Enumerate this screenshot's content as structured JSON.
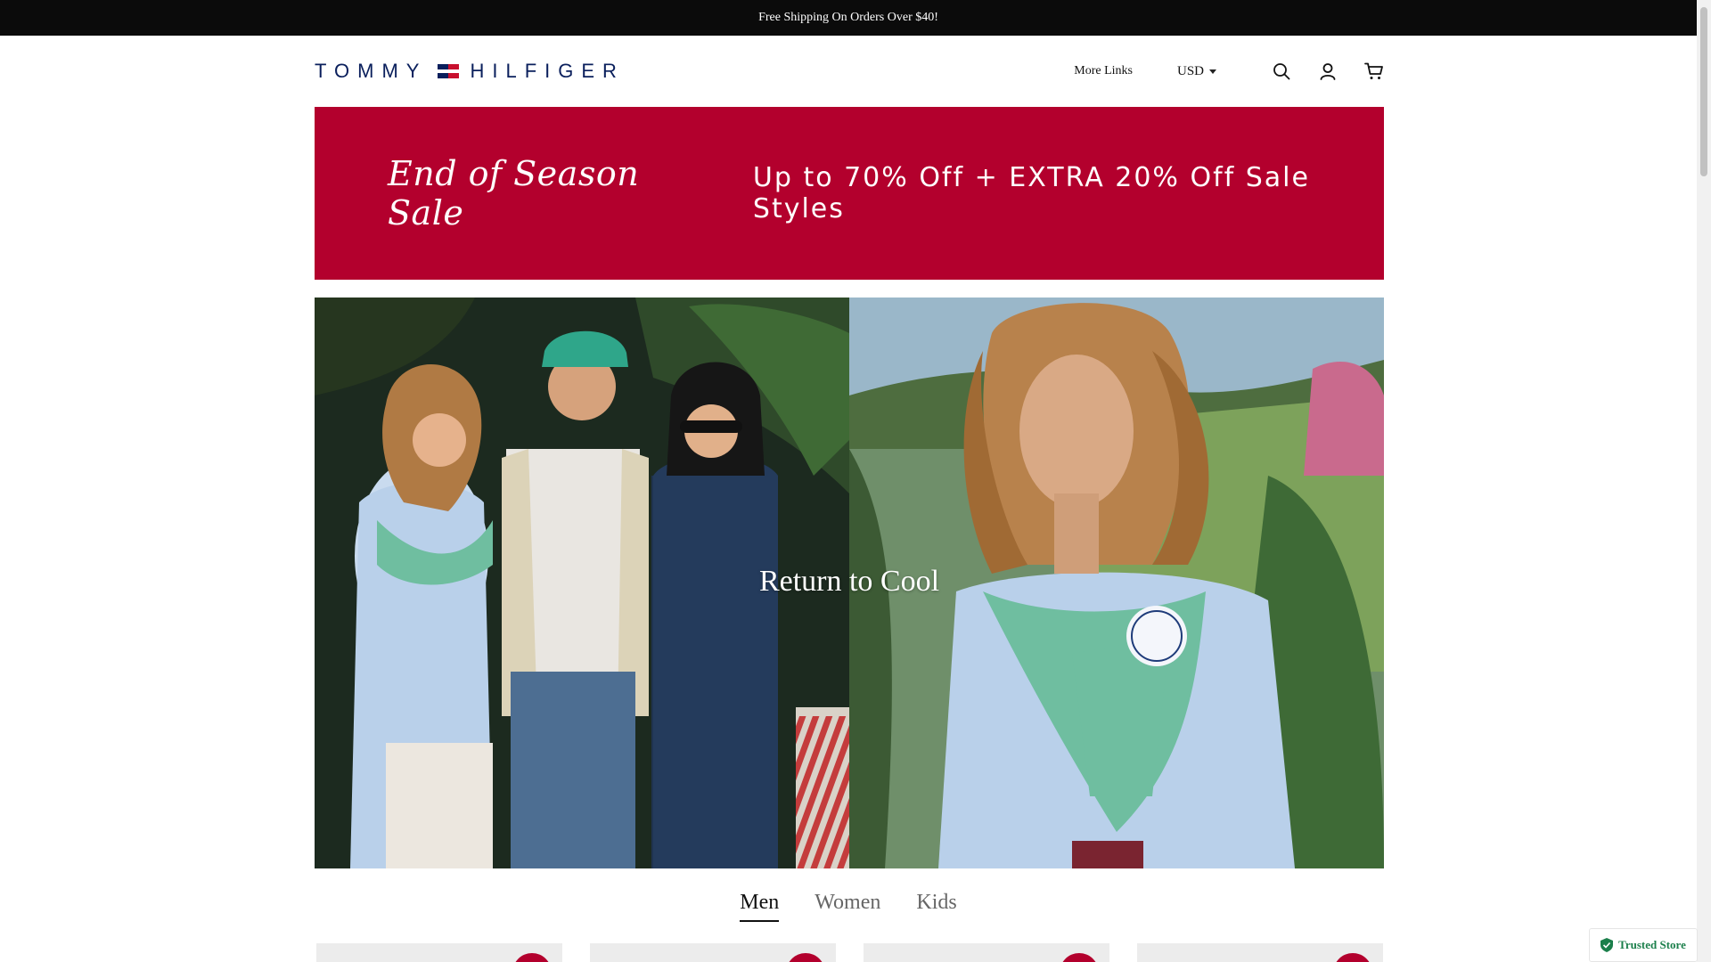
{
  "announcement": "Free Shipping On Orders Over $40!",
  "brand": {
    "left": "TOMMY",
    "right": "HILFIGER"
  },
  "nav": {
    "more_links": "More Links",
    "currency": "USD"
  },
  "icons": {
    "search": "search-icon",
    "account": "user-icon",
    "cart": "cart-icon"
  },
  "promo": {
    "script": "End of Season Sale",
    "offer": "Up to 70% Off  +  EXTRA 20% Off Sale Styles",
    "background": "#b3002d"
  },
  "hero": {
    "title": "Return to Cool"
  },
  "tabs": [
    {
      "label": "Men",
      "active": true
    },
    {
      "label": "Women",
      "active": false
    },
    {
      "label": "Kids",
      "active": false
    }
  ],
  "trusted_store": "Trusted Store",
  "colors": {
    "navy": "#0a1f5c",
    "red": "#c8102e",
    "sale_red": "#b3002d",
    "trusted_green": "#1b7f4b"
  }
}
